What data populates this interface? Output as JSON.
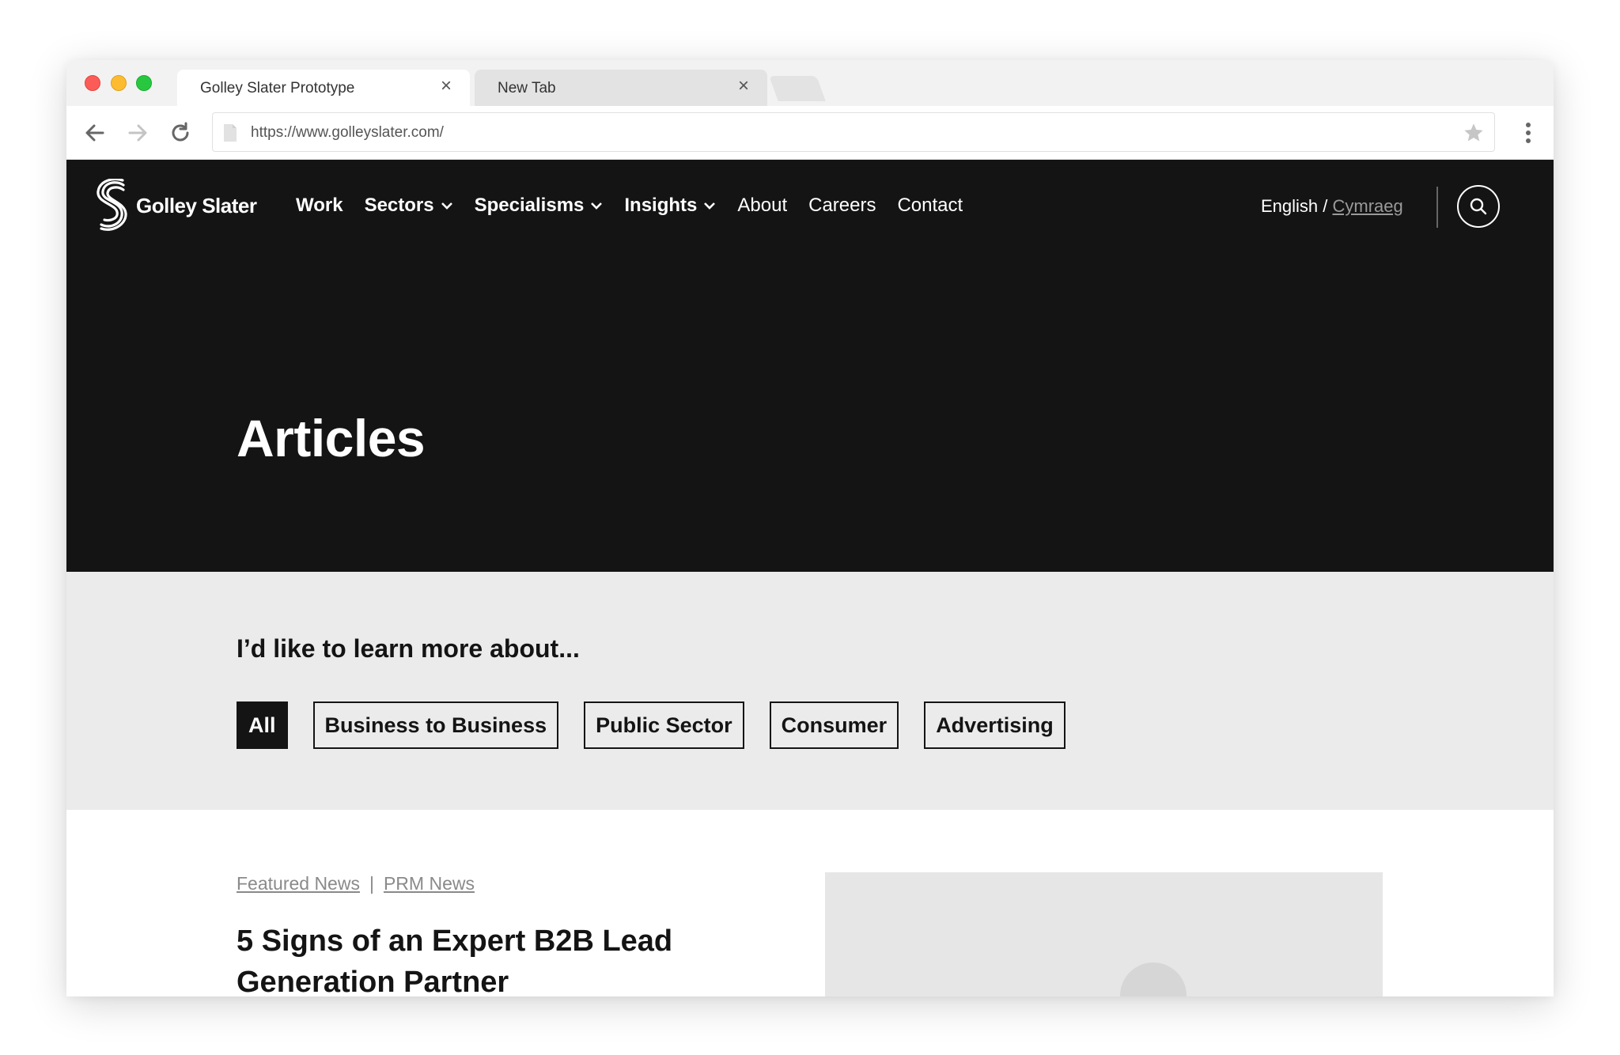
{
  "browser": {
    "tabs": [
      {
        "title": "Golley Slater Prototype",
        "active": true
      },
      {
        "title": "New Tab",
        "active": false
      }
    ],
    "close_glyph": "×",
    "url": "https://www.golleyslater.com/"
  },
  "site": {
    "brand": "Golley Slater",
    "nav": [
      {
        "label": "Work",
        "dropdown": false
      },
      {
        "label": "Sectors",
        "dropdown": true
      },
      {
        "label": "Specialisms",
        "dropdown": true
      },
      {
        "label": "Insights",
        "dropdown": true
      },
      {
        "label": "About",
        "dropdown": false
      },
      {
        "label": "Careers",
        "dropdown": false
      },
      {
        "label": "Contact",
        "dropdown": false
      }
    ],
    "lang": {
      "current": "English",
      "divider": " / ",
      "alt": "Cymraeg"
    }
  },
  "hero": {
    "title": "Articles"
  },
  "filters": {
    "heading": "I’d like to learn more about...",
    "pills": [
      {
        "label": "All",
        "active": true
      },
      {
        "label": "Business to Business",
        "active": false
      },
      {
        "label": "Public Sector",
        "active": false
      },
      {
        "label": "Consumer",
        "active": false
      },
      {
        "label": "Advertising",
        "active": false
      }
    ]
  },
  "article": {
    "tags": [
      "Featured News",
      "PRM News"
    ],
    "tag_separator": "|",
    "title": "5 Signs of an Expert B2B Lead Generation Partner"
  },
  "colors": {
    "hero_bg": "#141414",
    "filter_bg": "#ebebeb",
    "tag_text": "#8a8a8a"
  }
}
